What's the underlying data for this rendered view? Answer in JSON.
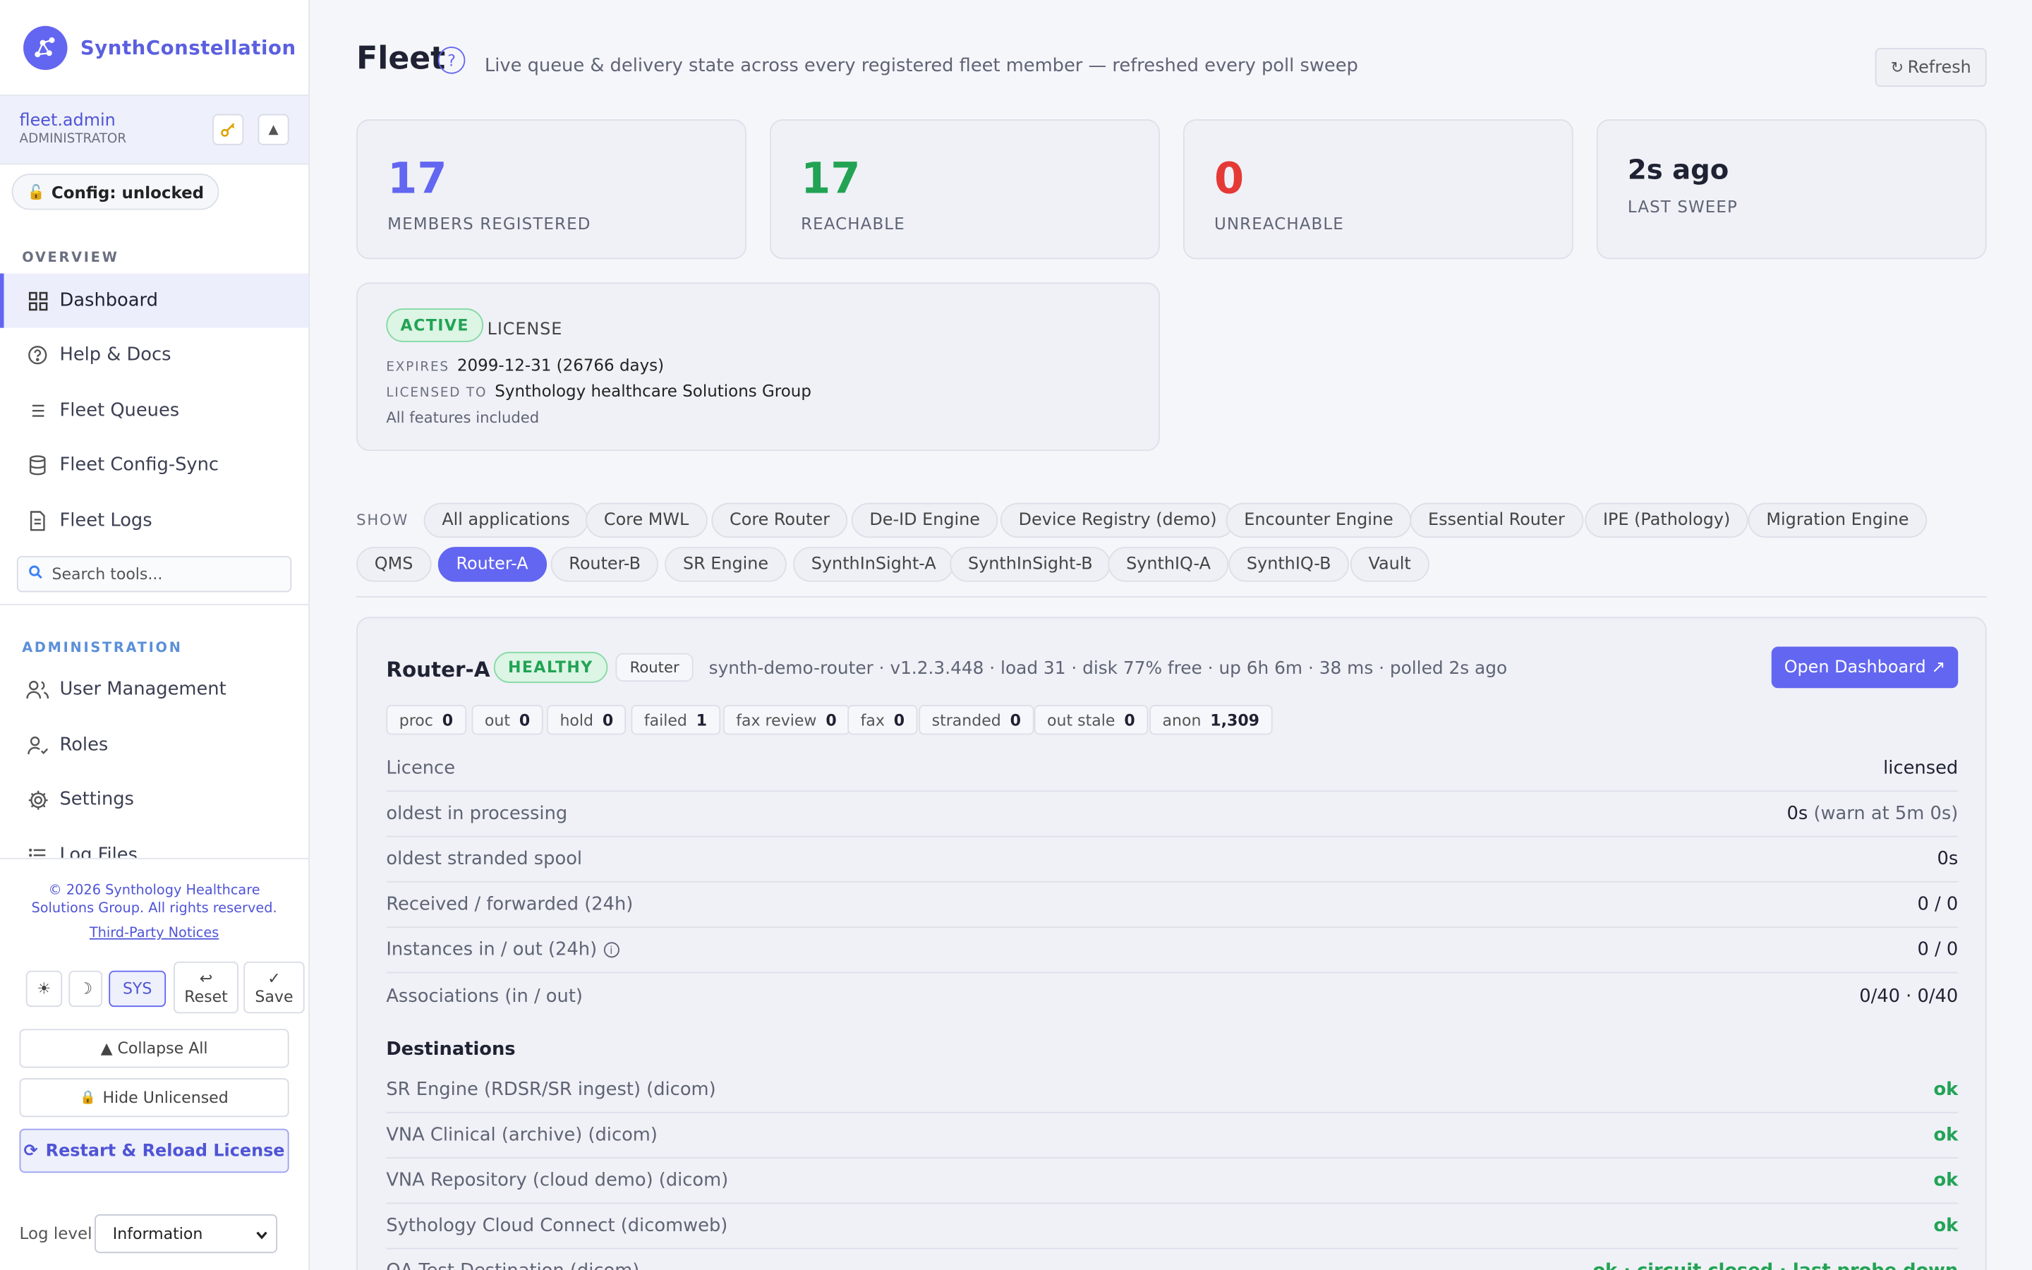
{
  "app": {
    "name": "SynthConstellation"
  },
  "user": {
    "name": "fleet.admin",
    "role": "ADMINISTRATOR"
  },
  "config_status": "Config: unlocked",
  "sidebar": {
    "overview_label": "OVERVIEW",
    "overview_items": [
      {
        "label": "Dashboard",
        "icon": "grid-icon",
        "active": true
      },
      {
        "label": "Help & Docs",
        "icon": "help-icon"
      },
      {
        "label": "Fleet Queues",
        "icon": "list-icon"
      },
      {
        "label": "Fleet Config-Sync",
        "icon": "database-icon"
      },
      {
        "label": "Fleet Logs",
        "icon": "document-icon"
      }
    ],
    "search_placeholder": "Search tools...",
    "admin_label": "ADMINISTRATION",
    "admin_items": [
      {
        "label": "User Management",
        "icon": "users-icon"
      },
      {
        "label": "Roles",
        "icon": "user-role-icon"
      },
      {
        "label": "Settings",
        "icon": "gear-icon"
      },
      {
        "label": "Log Files",
        "icon": "log-list-icon"
      }
    ],
    "copyright": "© 2026 Synthology Healthcare Solutions Group. All rights reserved.",
    "third_party": "Third-Party Notices",
    "theme_light": "☀",
    "theme_dark": "☽",
    "theme_sys": "SYS",
    "reset_label": "Reset",
    "save_label": "Save",
    "collapse_all": "▲ Collapse All",
    "hide_unlicensed": "Hide Unlicensed",
    "restart_reload": "Restart & Reload License",
    "log_level_label": "Log level",
    "log_level_value": "Information"
  },
  "header": {
    "title": "Fleet",
    "subtitle": "Live queue & delivery state across every registered fleet member — refreshed every poll sweep",
    "refresh_label": "Refresh"
  },
  "stats": [
    {
      "value": "17",
      "label": "MEMBERS REGISTERED",
      "color": "#6366f1"
    },
    {
      "value": "17",
      "label": "REACHABLE",
      "color": "#22a354"
    },
    {
      "value": "0",
      "label": "UNREACHABLE",
      "color": "#e53935"
    },
    {
      "value": "2s ago",
      "label": "LAST SWEEP",
      "color": "#1f2233"
    }
  ],
  "license": {
    "status": "ACTIVE",
    "label": "LICENSE",
    "expires_key": "EXPIRES",
    "expires_value": "2099-12-31 (26766 days)",
    "licensed_to_key": "LICENSED TO",
    "licensed_to_value": "Synthology healthcare Solutions Group",
    "features": "All features included"
  },
  "filters": {
    "label": "SHOW",
    "chips": [
      "All applications",
      "Core MWL",
      "Core Router",
      "De-ID Engine",
      "Device Registry (demo)",
      "Encounter Engine",
      "Essential Router",
      "IPE (Pathology)",
      "Migration Engine",
      "QMS",
      "Router-A",
      "Router-B",
      "SR Engine",
      "SynthInSight-A",
      "SynthInSight-B",
      "SynthIQ-A",
      "SynthIQ-B",
      "Vault"
    ],
    "selected": "Router-A"
  },
  "member": {
    "name": "Router-A",
    "health": "HEALTHY",
    "type": "Router",
    "meta": "synth-demo-router · v1.2.3.448 · load 31 · disk 77% free · up 6h 6m · 38 ms · polled 2s ago",
    "open_dashboard": "Open Dashboard ↗",
    "counters": [
      {
        "label": "proc",
        "value": "0"
      },
      {
        "label": "out",
        "value": "0"
      },
      {
        "label": "hold",
        "value": "0"
      },
      {
        "label": "failed",
        "value": "1"
      },
      {
        "label": "fax review",
        "value": "0"
      },
      {
        "label": "fax",
        "value": "0"
      },
      {
        "label": "stranded",
        "value": "0"
      },
      {
        "label": "out stale",
        "value": "0"
      },
      {
        "label": "anon",
        "value": "1,309"
      }
    ],
    "rows": [
      {
        "key": "Licence",
        "value": "licensed",
        "extra": ""
      },
      {
        "key": "oldest in processing",
        "value": "0s",
        "extra": " (warn at 5m 0s)"
      },
      {
        "key": "oldest stranded spool",
        "value": "0s",
        "extra": ""
      },
      {
        "key": "Received / forwarded (24h)",
        "value": "0 / 0",
        "extra": ""
      },
      {
        "key": "Instances in / out (24h)",
        "value": "0 / 0",
        "extra": ""
      },
      {
        "key": "Associations (in / out)",
        "value": "0/40 · 0/40",
        "extra": ""
      }
    ],
    "destinations_title": "Destinations",
    "destinations": [
      {
        "name": "SR Engine (RDSR/SR ingest) (dicom)",
        "status": "ok"
      },
      {
        "name": "VNA Clinical (archive) (dicom)",
        "status": "ok"
      },
      {
        "name": "VNA Repository (cloud demo) (dicom)",
        "status": "ok"
      },
      {
        "name": "Sythology Cloud Connect (dicomweb)",
        "status": "ok"
      },
      {
        "name": "QA Test Destination (dicom)",
        "status": "ok · circuit closed · last probe down"
      }
    ]
  }
}
